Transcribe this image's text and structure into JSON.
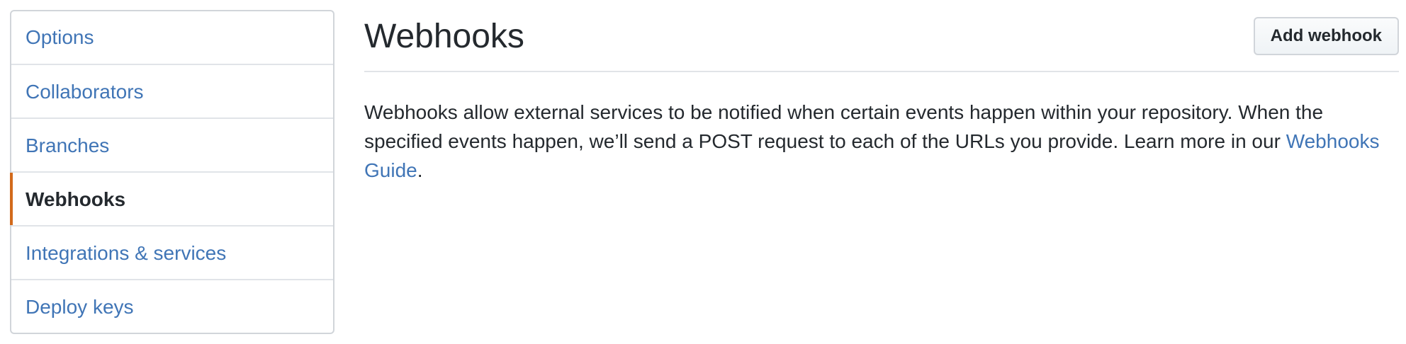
{
  "sidebar": {
    "items": [
      {
        "label": "Options"
      },
      {
        "label": "Collaborators"
      },
      {
        "label": "Branches"
      },
      {
        "label": "Webhooks"
      },
      {
        "label": "Integrations & services"
      },
      {
        "label": "Deploy keys"
      }
    ],
    "selected_label": "Webhooks",
    "accent_color": "#d26a1c",
    "link_color": "#4075b6"
  },
  "main": {
    "title": "Webhooks",
    "add_button_label": "Add webhook",
    "description_text": "Webhooks allow external services to be notified when certain events happen within your repository. When the specified events happen, we’ll send a POST request to each of the URLs you provide. Learn more in our ",
    "guide_link_label": "Webhooks Guide",
    "description_end": "."
  }
}
